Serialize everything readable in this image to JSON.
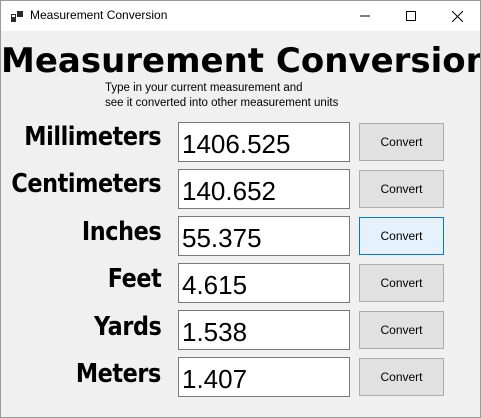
{
  "window": {
    "title": "Measurement Conversion"
  },
  "heading": "Measurement Conversion",
  "subtitle": {
    "line1": "Type in your current measurement and",
    "line2": "see it converted into other measurement units"
  },
  "rows": [
    {
      "label": "Millimeters",
      "value": "1406.525",
      "button": "Convert"
    },
    {
      "label": "Centimeters",
      "value": "140.652",
      "button": "Convert"
    },
    {
      "label": "Inches",
      "value": "55.375",
      "button": "Convert"
    },
    {
      "label": "Feet",
      "value": "4.615",
      "button": "Convert"
    },
    {
      "label": "Yards",
      "value": "1.538",
      "button": "Convert"
    },
    {
      "label": "Meters",
      "value": "1.407",
      "button": "Convert"
    }
  ],
  "icons": {
    "app": "app-window-icon",
    "minimize": "minimize-icon",
    "maximize": "maximize-icon",
    "close": "close-icon"
  }
}
